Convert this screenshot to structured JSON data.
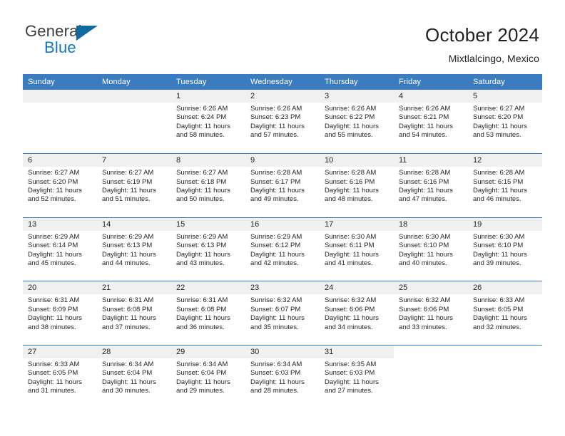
{
  "logo": {
    "word_one": "General",
    "word_two": "Blue",
    "triangle_icon": "triangle-icon"
  },
  "header": {
    "title": "October 2024",
    "subtitle": "Mixtlalcingo, Mexico"
  },
  "colors": {
    "header_blue": "#3b7cc0",
    "daynum_band": "#f0f0f0",
    "logo_blue": "#1277bd",
    "text": "#231f20"
  },
  "weekday_headers": [
    "Sunday",
    "Monday",
    "Tuesday",
    "Wednesday",
    "Thursday",
    "Friday",
    "Saturday"
  ],
  "weeks": [
    [
      {
        "day": "",
        "blank": true,
        "lines": []
      },
      {
        "day": "",
        "blank": true,
        "lines": []
      },
      {
        "day": "1",
        "lines": [
          "Sunrise: 6:26 AM",
          "Sunset: 6:24 PM",
          "Daylight: 11 hours",
          "and 58 minutes."
        ]
      },
      {
        "day": "2",
        "lines": [
          "Sunrise: 6:26 AM",
          "Sunset: 6:23 PM",
          "Daylight: 11 hours",
          "and 57 minutes."
        ]
      },
      {
        "day": "3",
        "lines": [
          "Sunrise: 6:26 AM",
          "Sunset: 6:22 PM",
          "Daylight: 11 hours",
          "and 55 minutes."
        ]
      },
      {
        "day": "4",
        "lines": [
          "Sunrise: 6:26 AM",
          "Sunset: 6:21 PM",
          "Daylight: 11 hours",
          "and 54 minutes."
        ]
      },
      {
        "day": "5",
        "lines": [
          "Sunrise: 6:27 AM",
          "Sunset: 6:20 PM",
          "Daylight: 11 hours",
          "and 53 minutes."
        ]
      }
    ],
    [
      {
        "day": "6",
        "lines": [
          "Sunrise: 6:27 AM",
          "Sunset: 6:20 PM",
          "Daylight: 11 hours",
          "and 52 minutes."
        ]
      },
      {
        "day": "7",
        "lines": [
          "Sunrise: 6:27 AM",
          "Sunset: 6:19 PM",
          "Daylight: 11 hours",
          "and 51 minutes."
        ]
      },
      {
        "day": "8",
        "lines": [
          "Sunrise: 6:27 AM",
          "Sunset: 6:18 PM",
          "Daylight: 11 hours",
          "and 50 minutes."
        ]
      },
      {
        "day": "9",
        "lines": [
          "Sunrise: 6:28 AM",
          "Sunset: 6:17 PM",
          "Daylight: 11 hours",
          "and 49 minutes."
        ]
      },
      {
        "day": "10",
        "lines": [
          "Sunrise: 6:28 AM",
          "Sunset: 6:16 PM",
          "Daylight: 11 hours",
          "and 48 minutes."
        ]
      },
      {
        "day": "11",
        "lines": [
          "Sunrise: 6:28 AM",
          "Sunset: 6:16 PM",
          "Daylight: 11 hours",
          "and 47 minutes."
        ]
      },
      {
        "day": "12",
        "lines": [
          "Sunrise: 6:28 AM",
          "Sunset: 6:15 PM",
          "Daylight: 11 hours",
          "and 46 minutes."
        ]
      }
    ],
    [
      {
        "day": "13",
        "lines": [
          "Sunrise: 6:29 AM",
          "Sunset: 6:14 PM",
          "Daylight: 11 hours",
          "and 45 minutes."
        ]
      },
      {
        "day": "14",
        "lines": [
          "Sunrise: 6:29 AM",
          "Sunset: 6:13 PM",
          "Daylight: 11 hours",
          "and 44 minutes."
        ]
      },
      {
        "day": "15",
        "lines": [
          "Sunrise: 6:29 AM",
          "Sunset: 6:13 PM",
          "Daylight: 11 hours",
          "and 43 minutes."
        ]
      },
      {
        "day": "16",
        "lines": [
          "Sunrise: 6:29 AM",
          "Sunset: 6:12 PM",
          "Daylight: 11 hours",
          "and 42 minutes."
        ]
      },
      {
        "day": "17",
        "lines": [
          "Sunrise: 6:30 AM",
          "Sunset: 6:11 PM",
          "Daylight: 11 hours",
          "and 41 minutes."
        ]
      },
      {
        "day": "18",
        "lines": [
          "Sunrise: 6:30 AM",
          "Sunset: 6:10 PM",
          "Daylight: 11 hours",
          "and 40 minutes."
        ]
      },
      {
        "day": "19",
        "lines": [
          "Sunrise: 6:30 AM",
          "Sunset: 6:10 PM",
          "Daylight: 11 hours",
          "and 39 minutes."
        ]
      }
    ],
    [
      {
        "day": "20",
        "lines": [
          "Sunrise: 6:31 AM",
          "Sunset: 6:09 PM",
          "Daylight: 11 hours",
          "and 38 minutes."
        ]
      },
      {
        "day": "21",
        "lines": [
          "Sunrise: 6:31 AM",
          "Sunset: 6:08 PM",
          "Daylight: 11 hours",
          "and 37 minutes."
        ]
      },
      {
        "day": "22",
        "lines": [
          "Sunrise: 6:31 AM",
          "Sunset: 6:08 PM",
          "Daylight: 11 hours",
          "and 36 minutes."
        ]
      },
      {
        "day": "23",
        "lines": [
          "Sunrise: 6:32 AM",
          "Sunset: 6:07 PM",
          "Daylight: 11 hours",
          "and 35 minutes."
        ]
      },
      {
        "day": "24",
        "lines": [
          "Sunrise: 6:32 AM",
          "Sunset: 6:06 PM",
          "Daylight: 11 hours",
          "and 34 minutes."
        ]
      },
      {
        "day": "25",
        "lines": [
          "Sunrise: 6:32 AM",
          "Sunset: 6:06 PM",
          "Daylight: 11 hours",
          "and 33 minutes."
        ]
      },
      {
        "day": "26",
        "lines": [
          "Sunrise: 6:33 AM",
          "Sunset: 6:05 PM",
          "Daylight: 11 hours",
          "and 32 minutes."
        ]
      }
    ],
    [
      {
        "day": "27",
        "lines": [
          "Sunrise: 6:33 AM",
          "Sunset: 6:05 PM",
          "Daylight: 11 hours",
          "and 31 minutes."
        ]
      },
      {
        "day": "28",
        "lines": [
          "Sunrise: 6:34 AM",
          "Sunset: 6:04 PM",
          "Daylight: 11 hours",
          "and 30 minutes."
        ]
      },
      {
        "day": "29",
        "lines": [
          "Sunrise: 6:34 AM",
          "Sunset: 6:04 PM",
          "Daylight: 11 hours",
          "and 29 minutes."
        ]
      },
      {
        "day": "30",
        "lines": [
          "Sunrise: 6:34 AM",
          "Sunset: 6:03 PM",
          "Daylight: 11 hours",
          "and 28 minutes."
        ]
      },
      {
        "day": "31",
        "lines": [
          "Sunrise: 6:35 AM",
          "Sunset: 6:03 PM",
          "Daylight: 11 hours",
          "and 27 minutes."
        ]
      },
      {
        "day": "",
        "blank": true,
        "lines": []
      },
      {
        "day": "",
        "blank": true,
        "lines": []
      }
    ]
  ]
}
